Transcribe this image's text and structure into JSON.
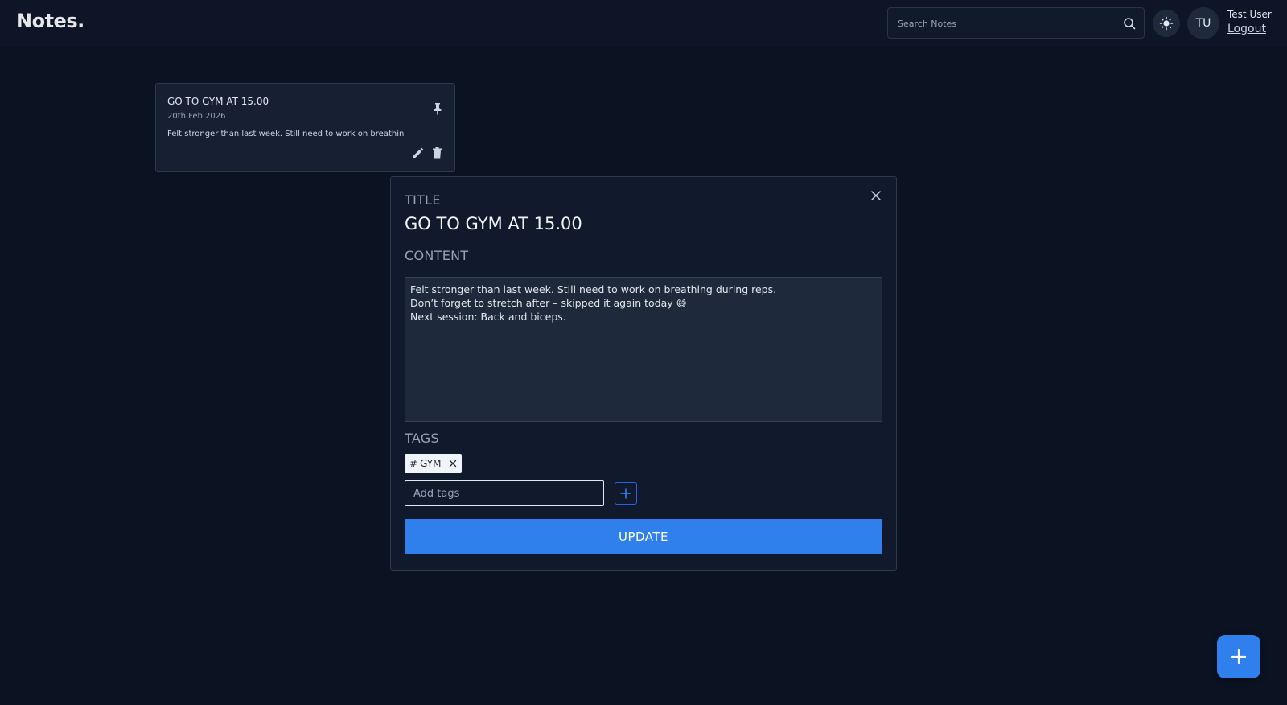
{
  "header": {
    "logo": "Notes.",
    "search_placeholder": "Search Notes",
    "avatar_initials": "TU",
    "user_name": "Test User",
    "logout_label": "Logout"
  },
  "notes": [
    {
      "title": "GO TO GYM AT 15.00",
      "date": "20th Feb 2026",
      "preview": "Felt stronger than last week. Still need to work on breathin"
    }
  ],
  "modal": {
    "title_label": "TITLE",
    "title_value": "GO TO GYM AT 15.00",
    "content_label": "CONTENT",
    "content_value": "Felt stronger than last week. Still need to work on breathing during reps.\nDon’t forget to stretch after – skipped it again today 😅\nNext session: Back and biceps.",
    "tags_label": "TAGS",
    "tags": [
      {
        "hash": "#",
        "name": "GYM"
      }
    ],
    "tags_placeholder": "Add tags",
    "update_label": "UPDATE"
  },
  "colors": {
    "background": "#0b1222",
    "accent": "#2f80ed",
    "card": "#172033"
  }
}
